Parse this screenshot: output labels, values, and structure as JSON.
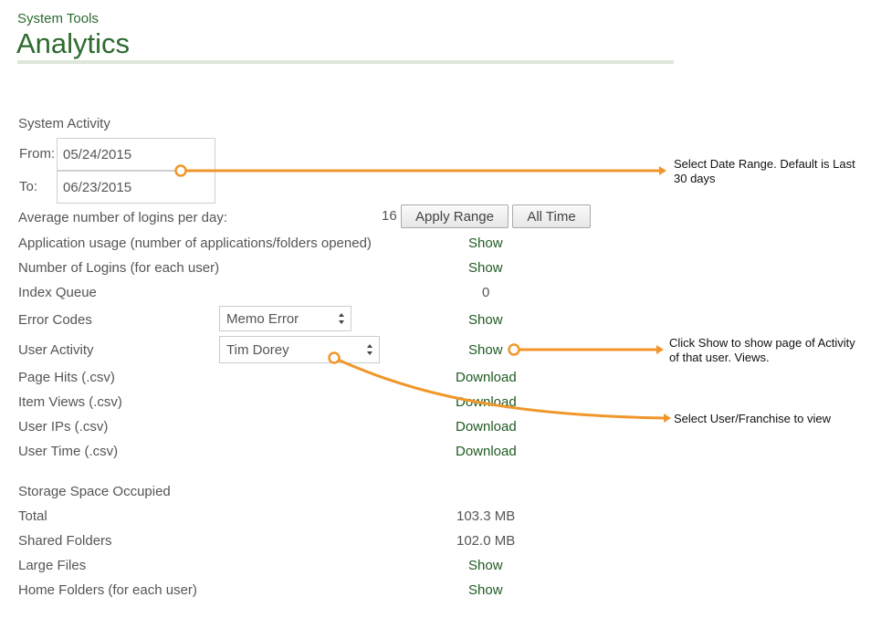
{
  "header": {
    "breadcrumb": "System Tools",
    "title": "Analytics"
  },
  "system_activity": {
    "heading": "System Activity",
    "from_label": "From:",
    "from_value": "05/24/2015",
    "to_label": "To:",
    "to_value": "06/23/2015",
    "apply_button": "Apply Range",
    "all_time_button": "All Time"
  },
  "rows": {
    "avg_logins": {
      "label": "Average number of logins per day:",
      "value": "16"
    },
    "app_usage": {
      "label": "Application usage (number of applications/folders opened)",
      "action": "Show"
    },
    "num_logins": {
      "label": "Number of Logins (for each user)",
      "action": "Show"
    },
    "index_queue": {
      "label": "Index Queue",
      "value": "0"
    },
    "error_codes": {
      "label": "Error Codes",
      "selected": "Memo Error",
      "action": "Show"
    },
    "user_activity": {
      "label": "User Activity",
      "selected": "Tim Dorey",
      "action": "Show"
    },
    "page_hits": {
      "label": "Page Hits (.csv)",
      "action": "Download"
    },
    "item_views": {
      "label": "Item Views (.csv)",
      "action": "Download"
    },
    "user_ips": {
      "label": "User IPs (.csv)",
      "action": "Download"
    },
    "user_time": {
      "label": "User Time (.csv)",
      "action": "Download"
    }
  },
  "storage": {
    "heading": "Storage Space Occupied",
    "total": {
      "label": "Total",
      "value": "103.3 MB"
    },
    "shared": {
      "label": "Shared Folders",
      "value": "102.0 MB"
    },
    "large": {
      "label": "Large Files",
      "action": "Show"
    },
    "home": {
      "label": "Home Folders (for each user)",
      "action": "Show"
    }
  },
  "annotations": {
    "date_range": "Select Date Range.  Default is Last 30 days",
    "show_activity": "Click Show to show page of Activity of that user.  Views.",
    "select_user": "Select User/Franchise to view"
  },
  "colors": {
    "brand_green": "#2d6a2f",
    "callout_orange": "#f0962a"
  }
}
